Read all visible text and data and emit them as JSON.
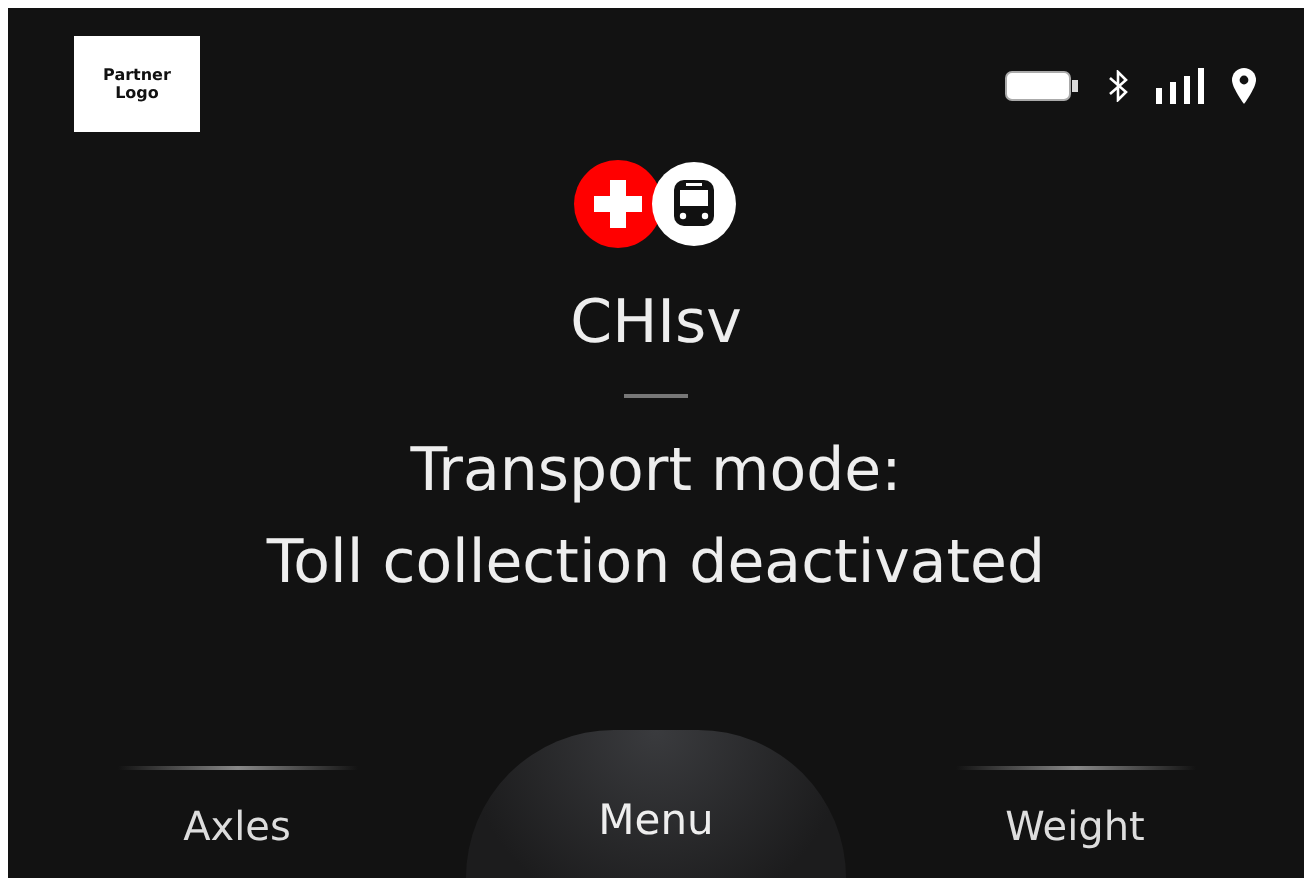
{
  "partner_logo": {
    "text": "Partner\nLogo"
  },
  "service": {
    "name": "CHIsv"
  },
  "message": {
    "lines": [
      "Transport mode:",
      "Toll collection deactivated"
    ]
  },
  "nav": [
    {
      "label": "Axles",
      "kind": "side"
    },
    {
      "label": "Menu",
      "kind": "center"
    },
    {
      "label": "Weight",
      "kind": "side"
    }
  ]
}
